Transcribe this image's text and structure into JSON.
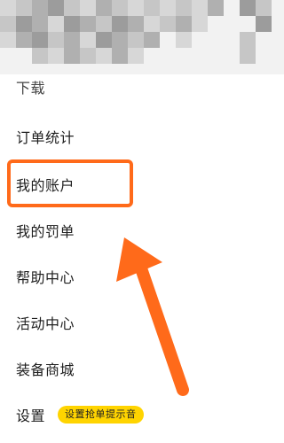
{
  "menu": {
    "partial_top_label": "下载",
    "items": [
      {
        "label": "订单统计"
      },
      {
        "label": "我的账户"
      },
      {
        "label": "我的罚单"
      },
      {
        "label": "帮助中心"
      },
      {
        "label": "活动中心"
      },
      {
        "label": "装备商城"
      },
      {
        "label": "设置"
      }
    ],
    "settings_badge": "设置抢单提示音"
  },
  "colors": {
    "accent": "#ff6a1a",
    "badge": "#ffd400"
  }
}
